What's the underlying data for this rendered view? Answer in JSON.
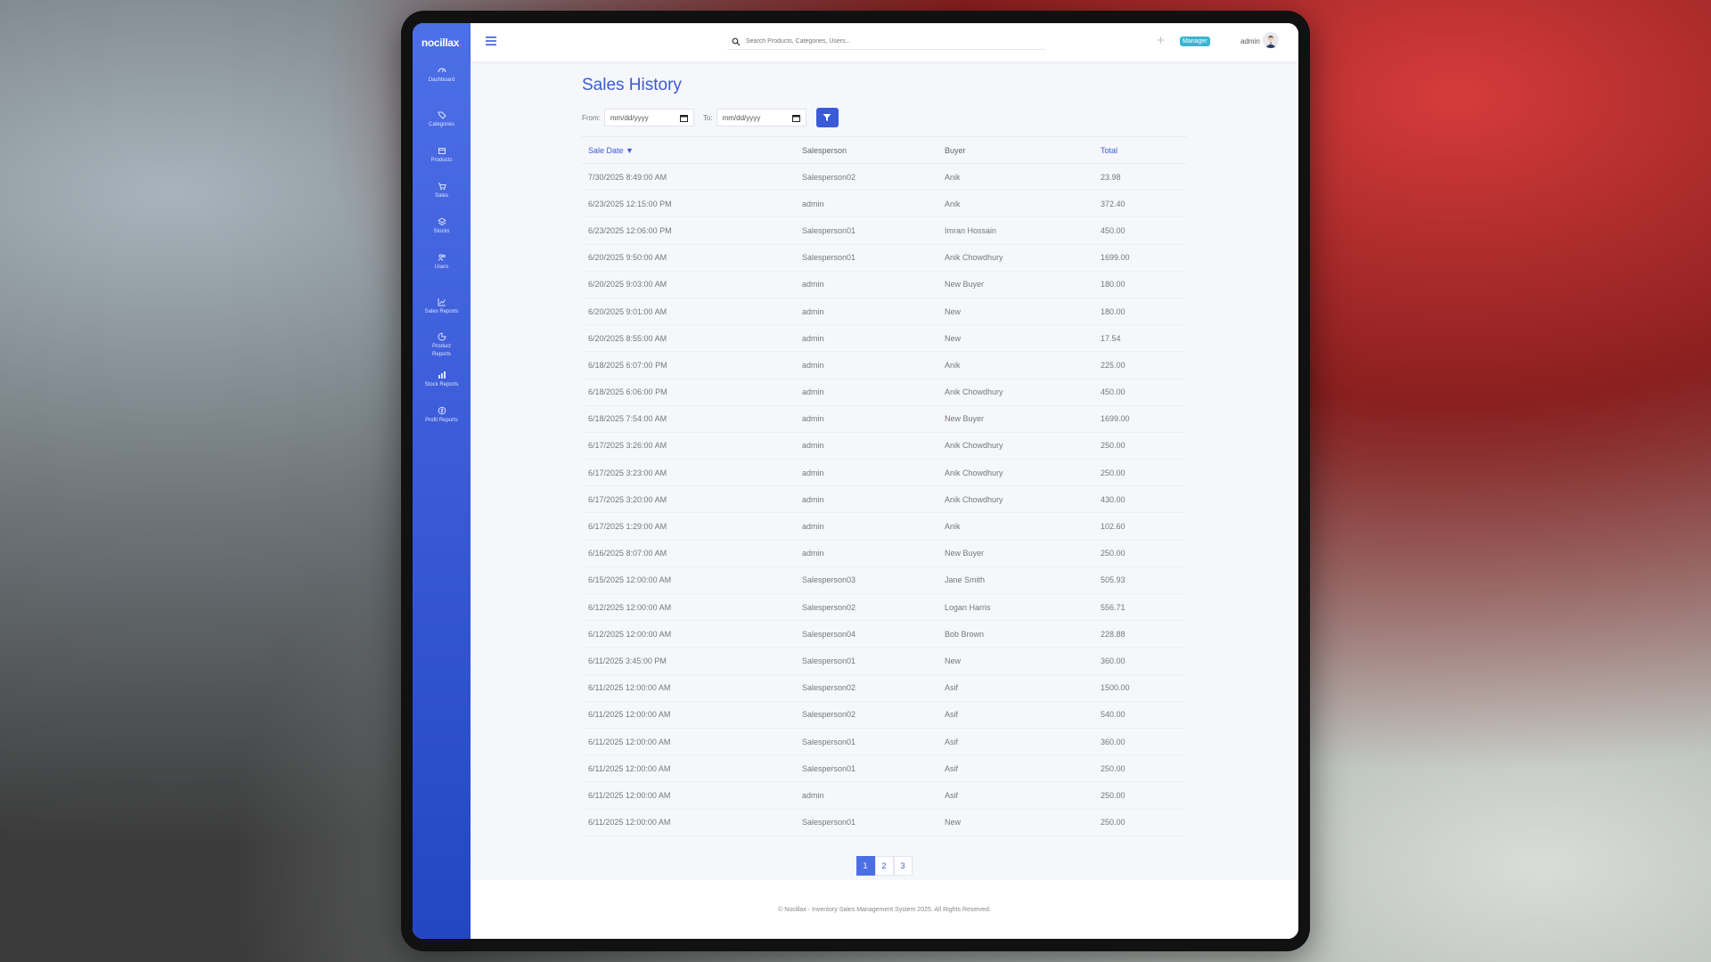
{
  "app": {
    "logo_text": "nocillax",
    "logo_dot": "."
  },
  "sidebar": {
    "items": [
      {
        "label": "Dashboard",
        "icon": "dashboard-icon"
      },
      {
        "label": "Categories",
        "icon": "tag-icon"
      },
      {
        "label": "Products",
        "icon": "box-icon"
      },
      {
        "label": "Sales",
        "icon": "cart-icon"
      },
      {
        "label": "Stocks",
        "icon": "layers-icon"
      },
      {
        "label": "Users",
        "icon": "users-icon"
      },
      {
        "label": "Sales Reports",
        "icon": "chart-icon"
      },
      {
        "label": "Product Reports",
        "icon": "report-icon"
      },
      {
        "label": "Stock Reports",
        "icon": "stock-report-icon"
      },
      {
        "label": "Profit Reports",
        "icon": "profit-icon"
      }
    ]
  },
  "topbar": {
    "search_placeholder": "Search Products, Categories, Users...",
    "plus_label": "+",
    "role_badge": "Manager",
    "username": "admin"
  },
  "page": {
    "title": "Sales History",
    "from_label": "From:",
    "to_label": "To:",
    "from_placeholder": "mm/dd/yyyy",
    "to_placeholder": "mm/dd/yyyy"
  },
  "table": {
    "headers": {
      "sale_date": "Sale Date ▼",
      "salesperson": "Salesperson",
      "buyer": "Buyer",
      "total": "Total"
    },
    "rows": [
      [
        "7/30/2025 8:49:00 AM",
        "Salesperson02",
        "Anik",
        "23.98"
      ],
      [
        "6/23/2025 12:15:00 PM",
        "admin",
        "Anik",
        "372.40"
      ],
      [
        "6/23/2025 12:06:00 PM",
        "Salesperson01",
        "Imran Hossain",
        "450.00"
      ],
      [
        "6/20/2025 9:50:00 AM",
        "Salesperson01",
        "Anik Chowdhury",
        "1699.00"
      ],
      [
        "6/20/2025 9:03:00 AM",
        "admin",
        "New Buyer",
        "180.00"
      ],
      [
        "6/20/2025 9:01:00 AM",
        "admin",
        "New",
        "180.00"
      ],
      [
        "6/20/2025 8:55:00 AM",
        "admin",
        "New",
        "17.54"
      ],
      [
        "6/18/2025 6:07:00 PM",
        "admin",
        "Anik",
        "225.00"
      ],
      [
        "6/18/2025 6:06:00 PM",
        "admin",
        "Anik Chowdhury",
        "450.00"
      ],
      [
        "6/18/2025 7:54:00 AM",
        "admin",
        "New Buyer",
        "1699.00"
      ],
      [
        "6/17/2025 3:26:00 AM",
        "admin",
        "Anik Chowdhury",
        "250.00"
      ],
      [
        "6/17/2025 3:23:00 AM",
        "admin",
        "Anik Chowdhury",
        "250.00"
      ],
      [
        "6/17/2025 3:20:00 AM",
        "admin",
        "Anik Chowdhury",
        "430.00"
      ],
      [
        "6/17/2025 1:29:00 AM",
        "admin",
        "Anik",
        "102.60"
      ],
      [
        "6/16/2025 8:07:00 AM",
        "admin",
        "New Buyer",
        "250.00"
      ],
      [
        "6/15/2025 12:00:00 AM",
        "Salesperson03",
        "Jane Smith",
        "505.93"
      ],
      [
        "6/12/2025 12:00:00 AM",
        "Salesperson02",
        "Logan Harris",
        "556.71"
      ],
      [
        "6/12/2025 12:00:00 AM",
        "Salesperson04",
        "Bob Brown",
        "228.88"
      ],
      [
        "6/11/2025 3:45:00 PM",
        "Salesperson01",
        "New",
        "360.00"
      ],
      [
        "6/11/2025 12:00:00 AM",
        "Salesperson02",
        "Asif",
        "1500.00"
      ],
      [
        "6/11/2025 12:00:00 AM",
        "Salesperson02",
        "Asif",
        "540.00"
      ],
      [
        "6/11/2025 12:00:00 AM",
        "Salesperson01",
        "Asif",
        "360.00"
      ],
      [
        "6/11/2025 12:00:00 AM",
        "Salesperson01",
        "Asif",
        "250.00"
      ],
      [
        "6/11/2025 12:00:00 AM",
        "admin",
        "Asif",
        "250.00"
      ],
      [
        "6/11/2025 12:00:00 AM",
        "Salesperson01",
        "New",
        "250.00"
      ]
    ]
  },
  "pagination": {
    "pages": [
      "1",
      "2",
      "3"
    ],
    "active": "1"
  },
  "footer": {
    "text": "© Nocillax - Inventory Sales Management System 2025. All Rights Reserved."
  },
  "colors": {
    "accent": "#3c5bd6",
    "sidebar_top": "#4d6fe6",
    "sidebar_bottom": "#2446c4",
    "badge": "#3ab5d1"
  }
}
